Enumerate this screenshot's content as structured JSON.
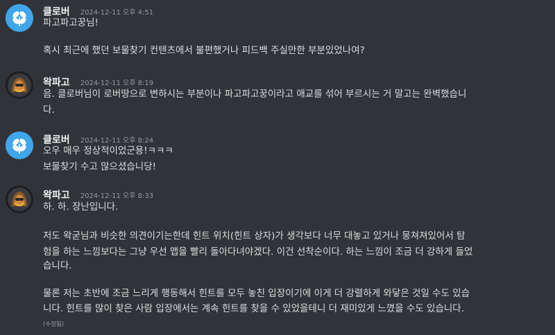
{
  "messages": [
    {
      "author": "클로버",
      "timestamp": "2024-12-11 오후 4:51",
      "avatar": "clover-avatar",
      "lines": [
        "파고파고꿍님!",
        "",
        "혹시 최근에 했던 보물찾기 컨텐츠에서 불편했거나 피드백 주실만한 부분있었나여?"
      ]
    },
    {
      "author": "왁파고",
      "timestamp": "2024-12-11 오후 8:19",
      "avatar": "wakpago-avatar",
      "lines": [
        "음. 클로버님이 로버땅으로 변하시는 부분이나 파고파고꿍이라고 애교를 섞어 부르시는 거 말고는 완벽했습니",
        "다."
      ]
    },
    {
      "author": "클로버",
      "timestamp": "2024-12-11 오후 8:24",
      "avatar": "clover-avatar",
      "lines": [
        "오우 매우 정상적이었군용!ㅋㅋㅋ",
        "보물찾기 수고 많으셨습니당!"
      ]
    },
    {
      "author": "왁파고",
      "timestamp": "2024-12-11 오후 8:33",
      "avatar": "wakpago-avatar",
      "lines": [
        "하. 하. 장난입니다.",
        "",
        "저도 왁굳님과 비슷한 의견이기는한데 힌트 위치(힌트 상자)가 생각보다 너무 대놓고 있거나 뭉쳐져있어서 탐",
        "험을 하는 느낌보다는 그냥 우선 맵을 빨리 돌아다녀야겠다. 이건 선착순이다. 하는 느낌이 조금 더 강하게 들었",
        "습니다.",
        "",
        "물론 저는 초반에 조금 느리게 행동해서 힌트를 모두 놓친 입장이기에 이게 더 강렬하게 와닿은 것일 수도 있습",
        "니다. 힌트를 많이 찾은 사람 입장에서는 계속 힌트를 찾을 수 있었을테니 더 재미있게 느꼈을 수도 있습니다."
      ],
      "edited": "(수정됨)"
    }
  ]
}
